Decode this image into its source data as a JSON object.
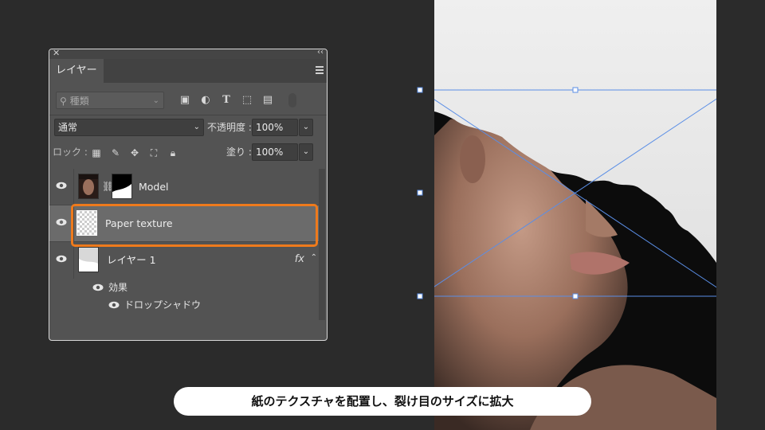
{
  "panel": {
    "tab_label": "レイヤー",
    "filter_placeholder": "種類",
    "blend_mode": "通常",
    "opacity_label": "不透明度 :",
    "opacity_value": "100%",
    "lock_label": "ロック :",
    "fill_label": "塗り :",
    "fill_value": "100%"
  },
  "layers": [
    {
      "name": "Model"
    },
    {
      "name": "Paper texture",
      "selected": true
    },
    {
      "name": "レイヤー 1",
      "fx": "fx"
    }
  ],
  "effects": {
    "group_label": "効果",
    "items": [
      "ドロップシャドウ"
    ]
  },
  "caption": "紙のテクスチャを配置し、裂け目のサイズに拡大",
  "colors": {
    "highlight": "#ee7a1c",
    "transform_box": "#5a8ee6"
  }
}
